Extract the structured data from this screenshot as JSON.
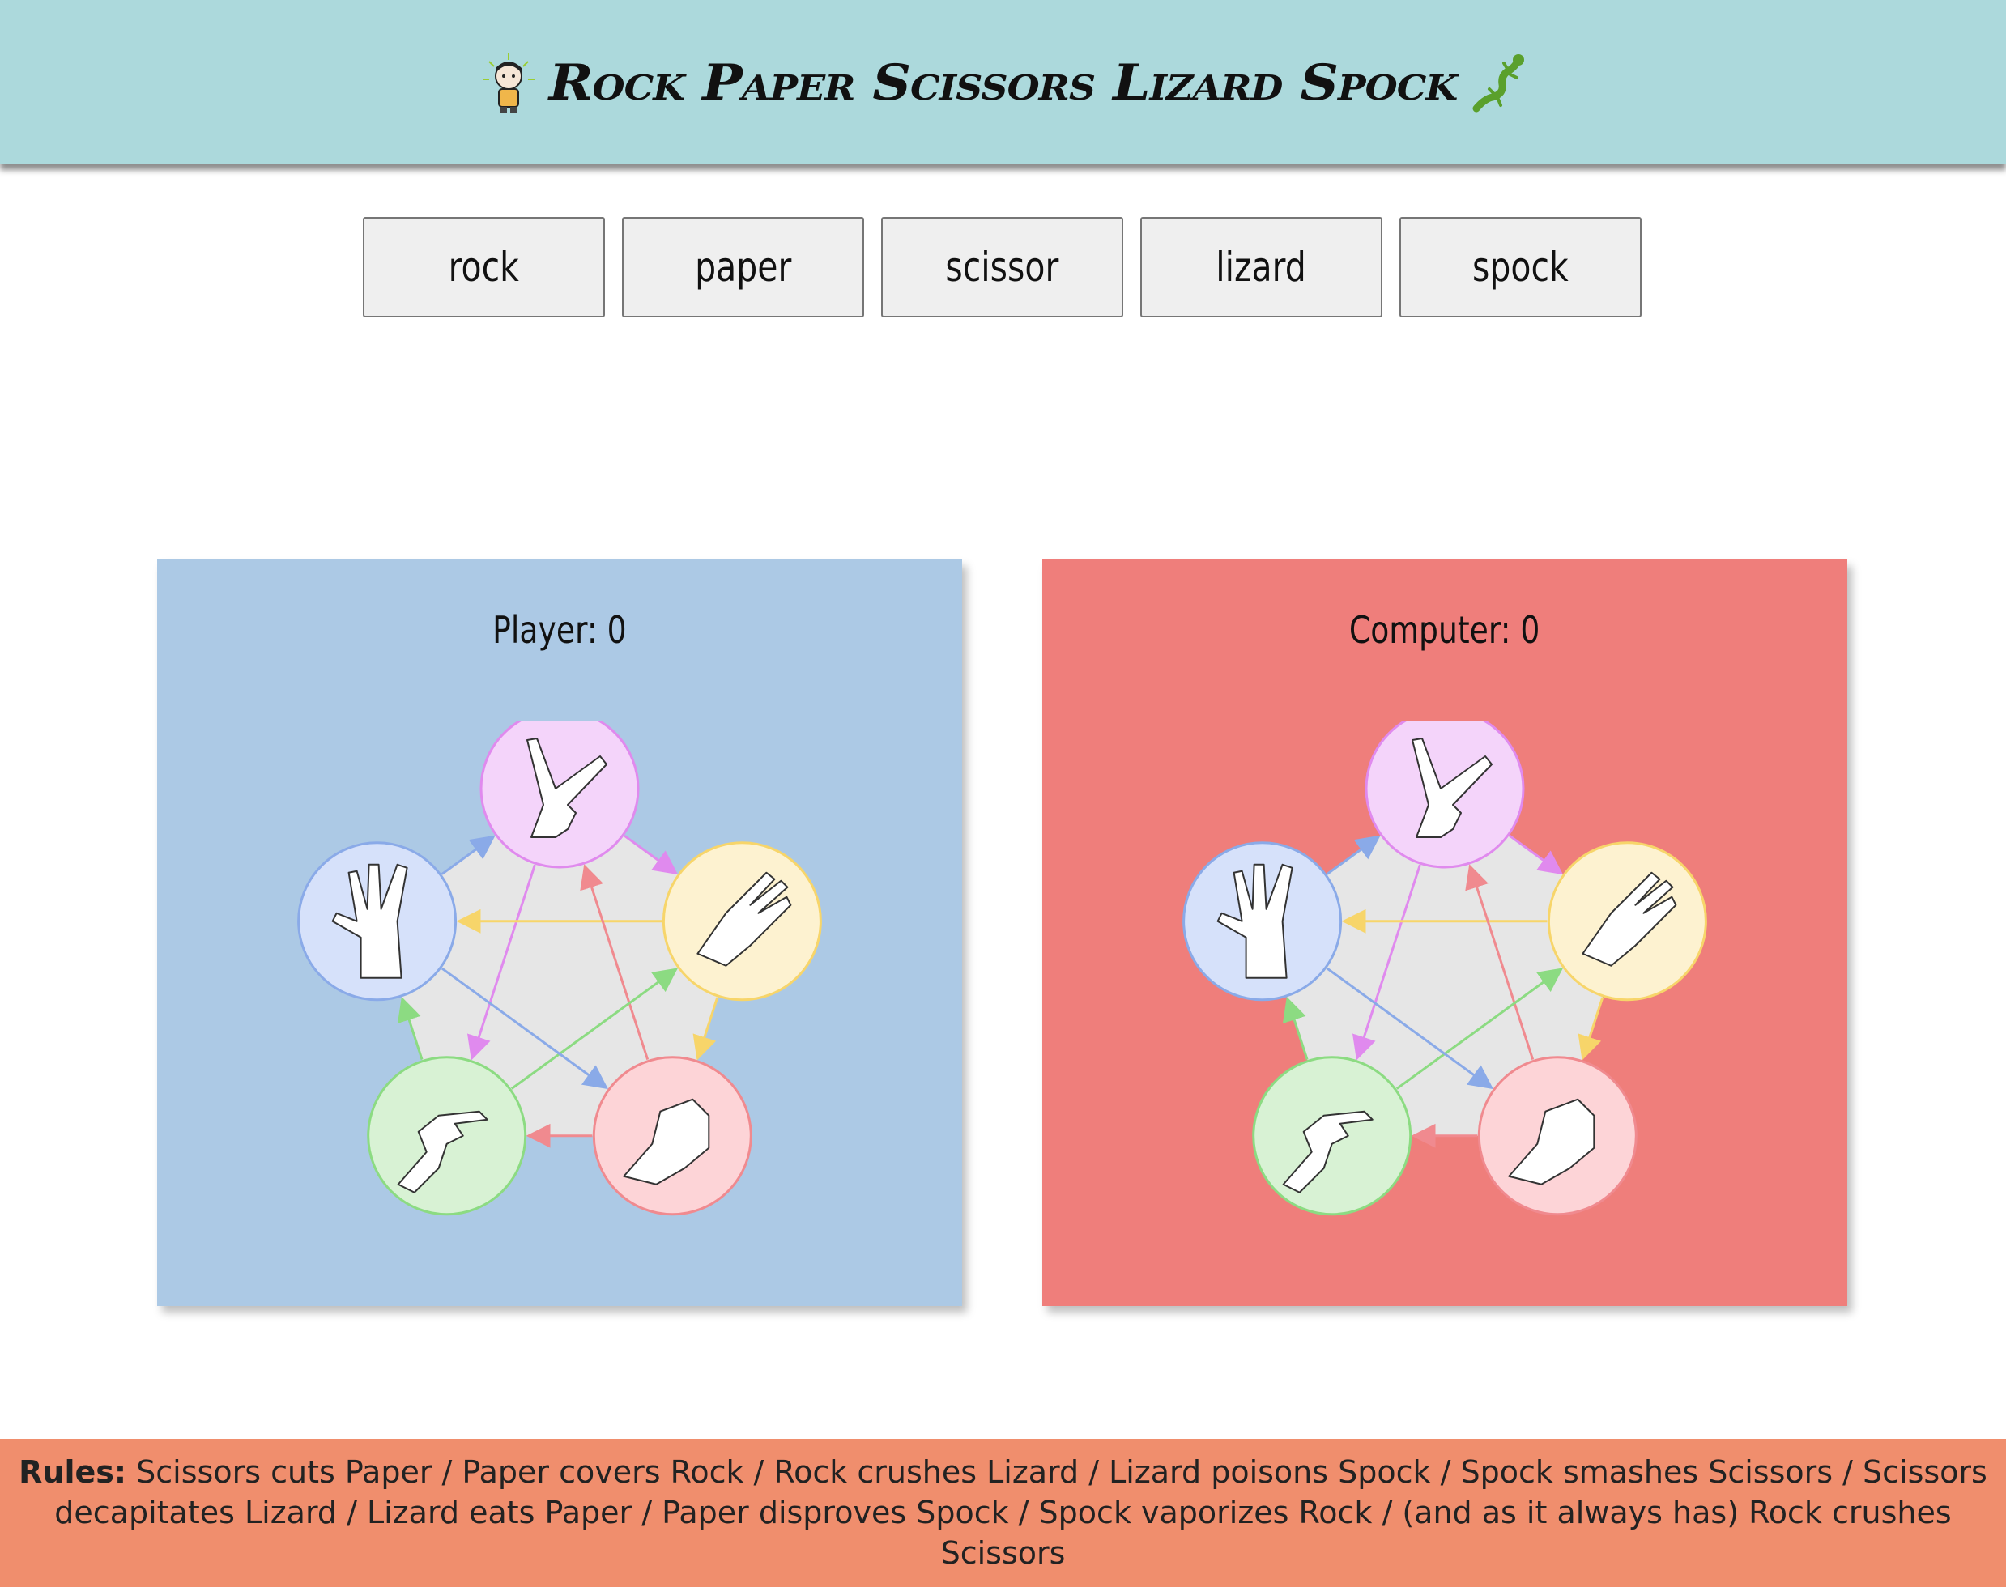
{
  "header": {
    "title": "Rock Paper Scissors Lizard Spock",
    "left_icon": "spock-avatar-icon",
    "right_icon": "lizard-icon"
  },
  "choices": [
    "rock",
    "paper",
    "scissor",
    "lizard",
    "spock"
  ],
  "player": {
    "label": "Player: 0",
    "background": "#acc9e5"
  },
  "computer": {
    "label": "Computer: 0",
    "background": "#ef7e7b"
  },
  "diagram": {
    "nodes": [
      {
        "name": "scissors-hand-icon",
        "fill": "#f4d4fa",
        "stroke": "#e08aee"
      },
      {
        "name": "paper-hand-icon",
        "fill": "#fdf2d0",
        "stroke": "#f7d56a"
      },
      {
        "name": "rock-hand-icon",
        "fill": "#fdd4d7",
        "stroke": "#f08a8f"
      },
      {
        "name": "lizard-hand-icon",
        "fill": "#d8f2d4",
        "stroke": "#8cdb82"
      },
      {
        "name": "spock-hand-icon",
        "fill": "#d6e1fa",
        "stroke": "#8aaae8"
      }
    ],
    "beats": [
      {
        "from": 0,
        "to": 1,
        "color": "#e08aee"
      },
      {
        "from": 1,
        "to": 2,
        "color": "#f7d56a"
      },
      {
        "from": 2,
        "to": 3,
        "color": "#f08a8f"
      },
      {
        "from": 3,
        "to": 4,
        "color": "#8cdb82"
      },
      {
        "from": 4,
        "to": 0,
        "color": "#8aaae8"
      },
      {
        "from": 0,
        "to": 3,
        "color": "#e08aee"
      },
      {
        "from": 1,
        "to": 4,
        "color": "#f7d56a"
      },
      {
        "from": 2,
        "to": 0,
        "color": "#f08a8f"
      },
      {
        "from": 3,
        "to": 1,
        "color": "#8cdb82"
      },
      {
        "from": 4,
        "to": 2,
        "color": "#8aaae8"
      }
    ]
  },
  "rules": {
    "label": "Rules:",
    "text": " Scissors cuts Paper / Paper covers Rock / Rock crushes Lizard / Lizard poisons Spock / Spock smashes Scissors / Scissors decapitates Lizard / Lizard eats Paper / Paper disproves Spock / Spock vaporizes Rock / (and as it always has) Rock crushes Scissors"
  }
}
